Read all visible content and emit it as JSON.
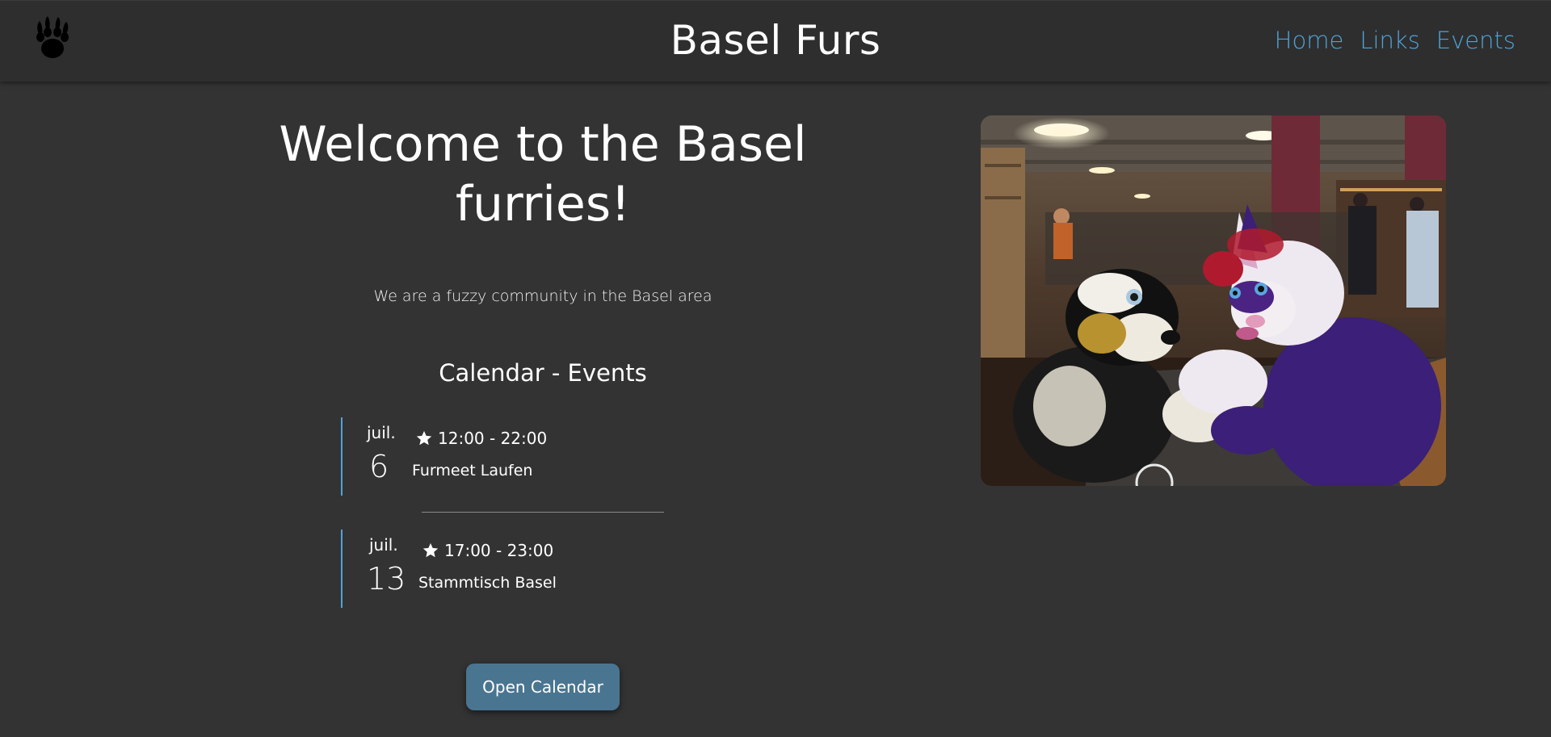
{
  "header": {
    "site_title": "Basel Furs",
    "logo_icon": "paw-icon",
    "nav": [
      {
        "label": "Home"
      },
      {
        "label": "Links"
      },
      {
        "label": "Events"
      }
    ],
    "accent_color": "#4fa3d9"
  },
  "main": {
    "welcome": "Welcome to the Basel furries!",
    "tagline": "We are a fuzzy community in the Basel area",
    "calendar_title": "Calendar - Events",
    "events": [
      {
        "month": "juil.",
        "day": "6",
        "time": "12:00 - 22:00",
        "name": "Furmeet Laufen"
      },
      {
        "month": "juil.",
        "day": "13",
        "time": "17:00 - 23:00",
        "name": "Stammtisch Basel"
      }
    ],
    "open_calendar_label": "Open Calendar",
    "button_color": "#4a7590"
  }
}
